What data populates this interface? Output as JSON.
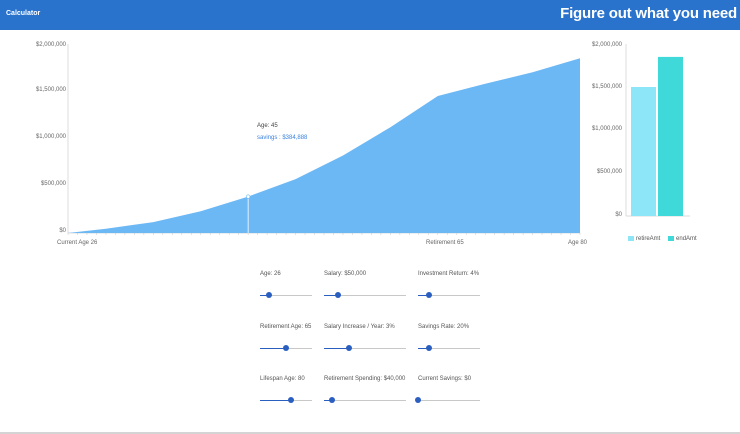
{
  "header": {
    "title": "Calculator",
    "tagline": "Figure out what you need"
  },
  "chart_data": [
    {
      "type": "area",
      "x": [
        26,
        30,
        35,
        40,
        45,
        50,
        55,
        60,
        65,
        70,
        75,
        80
      ],
      "values": [
        0,
        45000,
        115000,
        230000,
        384888,
        570000,
        820000,
        1120000,
        1450000,
        1580000,
        1700000,
        1850000
      ],
      "y_ticks": [
        "$0",
        "$500,000",
        "$1,000,000",
        "$1,500,000",
        "$2,000,000"
      ],
      "ylim": [
        0,
        2000000
      ],
      "x_labels": [
        {
          "age": 26,
          "text": "Current Age 26"
        },
        {
          "age": 65,
          "text": "Retirement 65"
        },
        {
          "age": 80,
          "text": "Age 80"
        }
      ],
      "fill_color": "#6cb8f5",
      "tooltip": {
        "age_label": "Age: 45",
        "value_label": "savings : $384,888",
        "age": 45,
        "value": 384888
      },
      "grid": false
    },
    {
      "type": "bar",
      "series": [
        {
          "name": "retireAmt",
          "value": 1500000,
          "color": "#8de6f7"
        },
        {
          "name": "endAmt",
          "value": 1850000,
          "color": "#3fd9d9"
        }
      ],
      "y_ticks": [
        "$0",
        "$500,000",
        "$1,000,000",
        "$1,500,000",
        "$2,000,000"
      ],
      "ylim": [
        0,
        2000000
      ],
      "legend_position": "bottom"
    }
  ],
  "controls": [
    {
      "key": "age",
      "label": "Age: 26",
      "fraction": 0.18
    },
    {
      "key": "salary",
      "label": "Salary: $50,000",
      "fraction": 0.17
    },
    {
      "key": "return",
      "label": "Investment Return: 4%",
      "fraction": 0.18
    },
    {
      "key": "retire_age",
      "label": "Retirement Age: 65",
      "fraction": 0.5
    },
    {
      "key": "salary_increase",
      "label": "Salary Increase / Year: 3%",
      "fraction": 0.3
    },
    {
      "key": "savings_rate",
      "label": "Savings Rate: 20%",
      "fraction": 0.18
    },
    {
      "key": "lifespan",
      "label": "Lifespan Age: 80",
      "fraction": 0.6
    },
    {
      "key": "ret_spending",
      "label": "Retirement Spending: $40,000",
      "fraction": 0.1
    },
    {
      "key": "current_savings",
      "label": "Current Savings: $0",
      "fraction": 0.0
    }
  ]
}
